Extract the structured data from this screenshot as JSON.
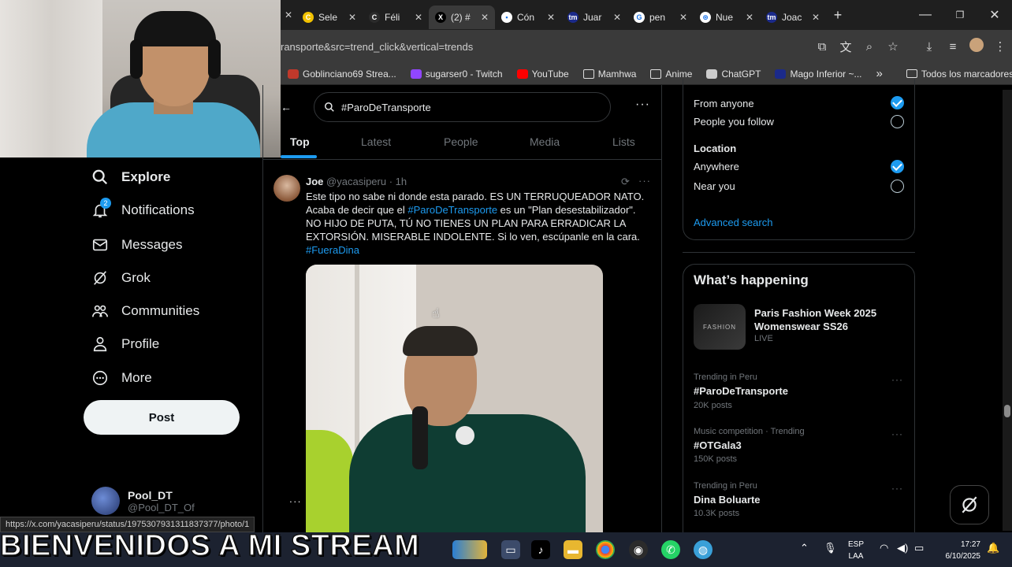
{
  "browser": {
    "tabs": [
      {
        "title": "Sele",
        "fav_color": "#f2c200",
        "fav_glyph": "C"
      },
      {
        "title": "Féli",
        "fav_color": "#2b2b2b",
        "fav_glyph": "C"
      },
      {
        "title": "(2) #",
        "fav_color": "#000000",
        "fav_glyph": "X",
        "active": true
      },
      {
        "title": "Cón",
        "fav_color": "#ffffff",
        "fav_glyph": "▪"
      },
      {
        "title": "Juar",
        "fav_color": "#1b2a8a",
        "fav_glyph": "tm"
      },
      {
        "title": "pen",
        "fav_color": "#ffffff",
        "fav_glyph": "G"
      },
      {
        "title": "Nue",
        "fav_color": "#ffffff",
        "fav_glyph": "⊛"
      },
      {
        "title": "Joac",
        "fav_color": "#1b2a8a",
        "fav_glyph": "tm"
      }
    ],
    "url": "ransporte&src=trend_click&vertical=trends",
    "bookmarks": [
      {
        "label": "Goblinciano69 Strea...",
        "icon_color": "#c0392b"
      },
      {
        "label": "sugarser0 - Twitch",
        "icon_color": "#9146ff"
      },
      {
        "label": "YouTube",
        "icon_color": "#ff0000"
      },
      {
        "label": "Mamhwa",
        "icon_color": "folder"
      },
      {
        "label": "Anime",
        "icon_color": "folder"
      },
      {
        "label": "ChatGPT",
        "icon_color": "#cccccc"
      },
      {
        "label": "Mago Inferior ~...",
        "icon_color": "#1b2a8a"
      }
    ],
    "bookmarks_more": "»",
    "all_bookmarks": "Todos los marcadores"
  },
  "nav": {
    "explore": "Explore",
    "notifications": "Notifications",
    "notifications_badge": "2",
    "messages": "Messages",
    "grok": "Grok",
    "communities": "Communities",
    "profile": "Profile",
    "more": "More",
    "post": "Post"
  },
  "account": {
    "name": "Pool_DT",
    "handle": "@Pool_DT_Of"
  },
  "status_url": "https://x.com/yacasiperu/status/1975307931311837377/photo/1",
  "search": {
    "query": "#ParoDeTransporte",
    "more": "···",
    "tabs": [
      "Top",
      "Latest",
      "People",
      "Media",
      "Lists"
    ]
  },
  "tweet": {
    "name": "Joe",
    "handle": "@yacasiperu · 1h",
    "more": "···",
    "line1": "Este tipo no sabe ni donde esta parado. ES UN TERRUQUEADOR NATO.",
    "line2a": "Acaba de decir que el ",
    "line2_tag": "#ParoDeTransporte",
    "line2b": " es un \"Plan desestabilizador\".",
    "line3": "NO HIJO DE PUTA, TÚ NO TIENES UN PLAN PARA ERRADICAR LA",
    "line4": "EXTORSIÓN. MISERABLE INDOLENTE. Si lo ven, escúpanle en la cara.",
    "line5_tag": "#FueraDina"
  },
  "filters": {
    "from_anyone": "From anyone",
    "people_you_follow": "People you follow",
    "location": "Location",
    "anywhere": "Anywhere",
    "near_you": "Near you",
    "advanced_search": "Advanced search"
  },
  "happening": {
    "title": "What’s happening",
    "featured": {
      "title": "Paris Fashion Week 2025 Womenswear SS26",
      "status": "LIVE",
      "thumb_text": "FASHION"
    },
    "trends": [
      {
        "meta": "Trending in Peru",
        "name": "#ParoDeTransporte",
        "count": "20K posts"
      },
      {
        "meta": "Music competition · Trending",
        "name": "#OTGala3",
        "count": "150K posts"
      },
      {
        "meta": "Trending in Peru",
        "name": "Dina Boluarte",
        "count": "10.3K posts"
      }
    ],
    "more": "···"
  },
  "overlay": {
    "banner": "BIENVENIDOS A MI STREAM"
  },
  "taskbar": {
    "lang_line1": "ESP",
    "lang_line2": "LAA",
    "time": "17:27",
    "date": "6/10/2025"
  }
}
